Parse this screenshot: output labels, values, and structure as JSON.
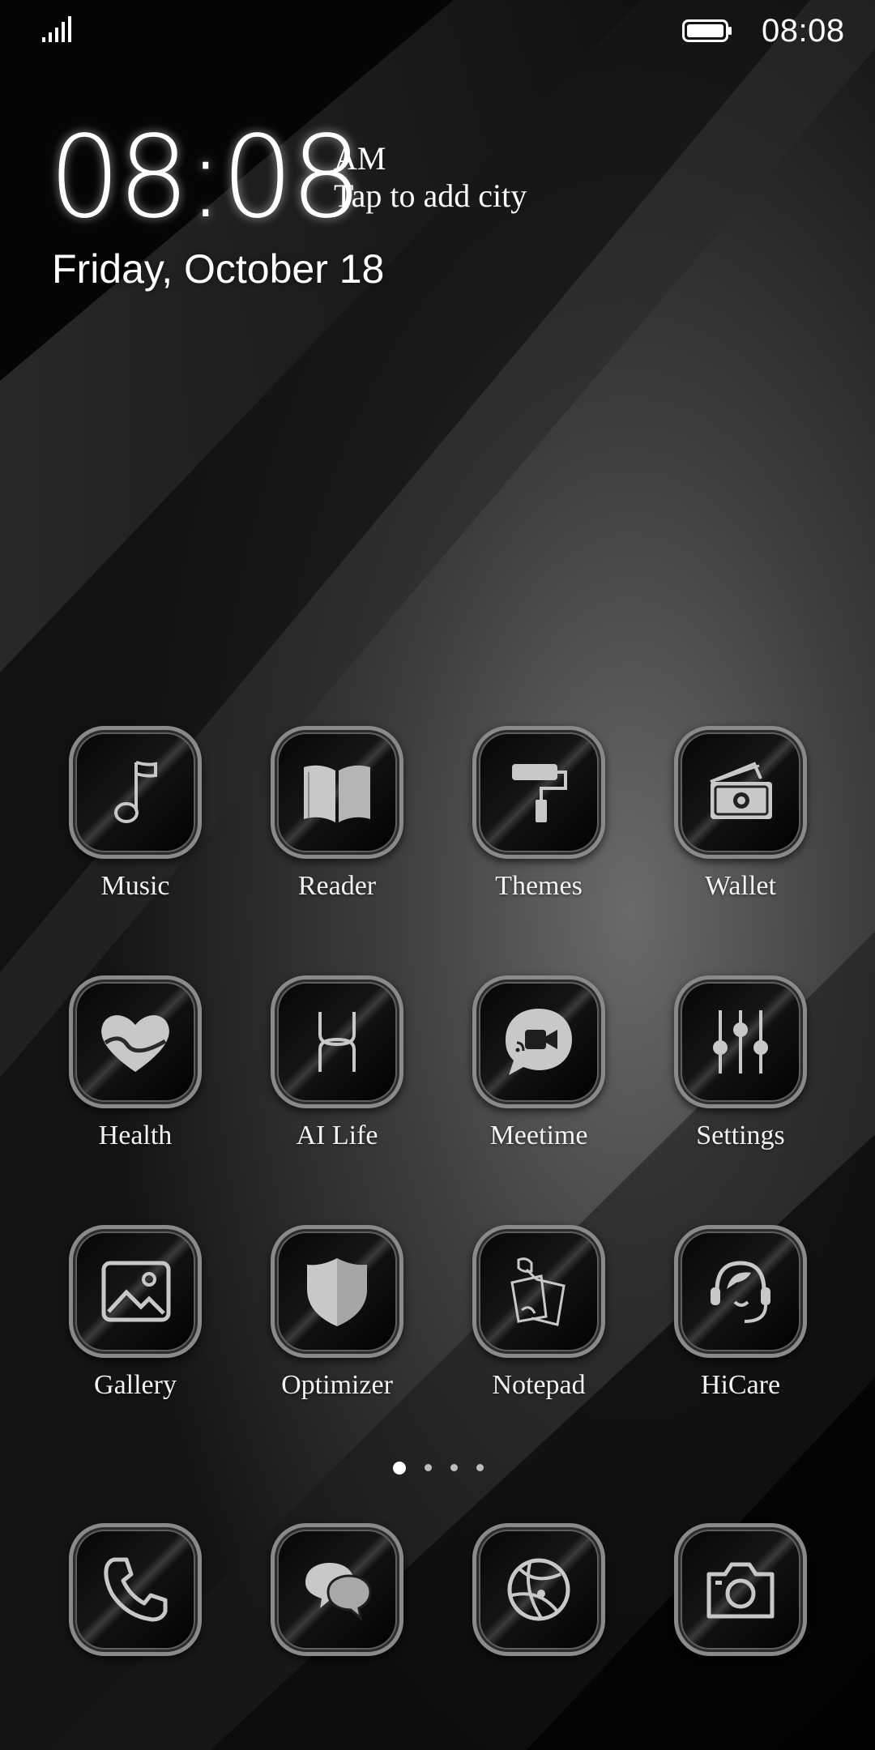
{
  "status_bar": {
    "signal_icon": "signal-strength-icon",
    "battery_icon": "battery-icon",
    "time": "08:08"
  },
  "clock_widget": {
    "time": "08:08",
    "ampm": "AM",
    "city_prompt": "Tap to add city",
    "date": "Friday, October 18"
  },
  "apps": [
    {
      "label": "Music",
      "icon": "music-note-icon"
    },
    {
      "label": "Reader",
      "icon": "open-book-icon"
    },
    {
      "label": "Themes",
      "icon": "paint-roller-icon"
    },
    {
      "label": "Wallet",
      "icon": "wallet-cash-icon"
    },
    {
      "label": "Health",
      "icon": "heart-icon"
    },
    {
      "label": "AI Life",
      "icon": "ai-life-icon"
    },
    {
      "label": "Meetime",
      "icon": "video-chat-icon"
    },
    {
      "label": "Settings",
      "icon": "sliders-icon"
    },
    {
      "label": "Gallery",
      "icon": "image-icon"
    },
    {
      "label": "Optimizer",
      "icon": "shield-icon"
    },
    {
      "label": "Notepad",
      "icon": "notepad-icon"
    },
    {
      "label": "HiCare",
      "icon": "headset-agent-icon"
    }
  ],
  "page_indicator": {
    "pages": 4,
    "current": 1
  },
  "dock": [
    {
      "icon": "phone-icon"
    },
    {
      "icon": "messages-icon"
    },
    {
      "icon": "browser-icon"
    },
    {
      "icon": "camera-icon"
    }
  ],
  "colors": {
    "tile_border": "#8a8a8a",
    "icon_fill": "#c8c8c8",
    "wallpaper_dark": "#0d0d0d",
    "wallpaper_light": "#5a5a5a"
  }
}
